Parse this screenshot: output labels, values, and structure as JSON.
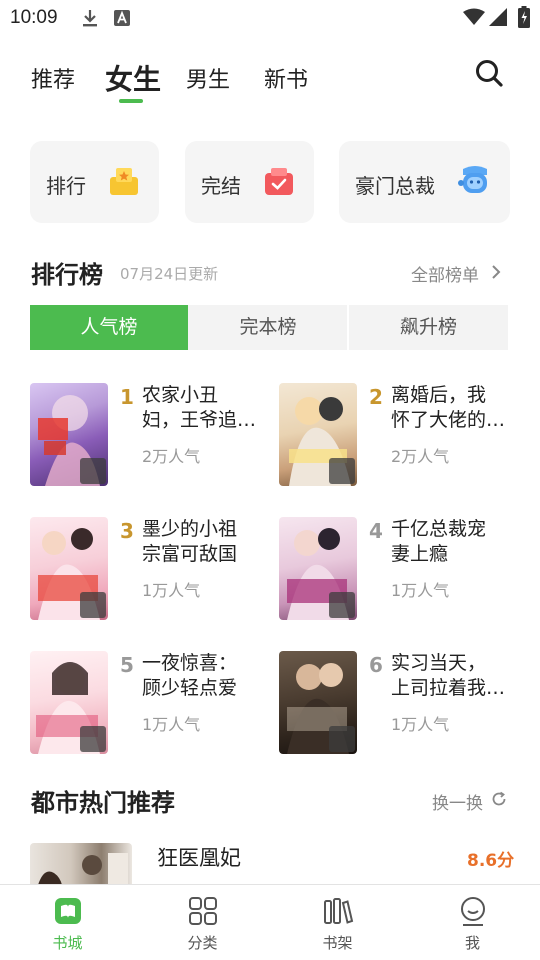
{
  "status_bar": {
    "time": "10:09"
  },
  "top_tabs": [
    {
      "label": "推荐"
    },
    {
      "label": "女生"
    },
    {
      "label": "男生"
    },
    {
      "label": "新书"
    }
  ],
  "active_top_tab": "女生",
  "shortcuts": [
    {
      "label": "排行",
      "icon": "trophy-icon"
    },
    {
      "label": "完结",
      "icon": "box-check-icon"
    },
    {
      "label": "豪门总裁",
      "icon": "mascot-icon"
    }
  ],
  "ranking": {
    "title": "排行榜",
    "updated": "07月24日更新",
    "all_link": "全部榜单",
    "tabs": [
      "人气榜",
      "完本榜",
      "飙升榜"
    ],
    "active_tab": "人气榜",
    "items": [
      {
        "rank": "1",
        "title_line1": "农家小丑",
        "title_line2": "妇，王爷追…",
        "popularity": "2万人气"
      },
      {
        "rank": "2",
        "title_line1": "离婚后，我",
        "title_line2": "怀了大佬的…",
        "popularity": "2万人气"
      },
      {
        "rank": "3",
        "title_line1": "墨少的小祖",
        "title_line2": "宗富可敌国",
        "popularity": "1万人气"
      },
      {
        "rank": "4",
        "title_line1": "千亿总裁宠",
        "title_line2": "妻上瘾",
        "popularity": "1万人气"
      },
      {
        "rank": "5",
        "title_line1": "一夜惊喜：",
        "title_line2": "顾少轻点爱",
        "popularity": "1万人气"
      },
      {
        "rank": "6",
        "title_line1": "实习当天，",
        "title_line2": "上司拉着我…",
        "popularity": "1万人气"
      }
    ]
  },
  "city_section": {
    "title": "都市热门推荐",
    "refresh": "换一换",
    "book": {
      "title": "狂医凰妃",
      "score": "8.6分"
    }
  },
  "bottom_nav": [
    {
      "label": "书城",
      "icon": "bookstore-icon"
    },
    {
      "label": "分类",
      "icon": "grid-icon"
    },
    {
      "label": "书架",
      "icon": "bookshelf-icon"
    },
    {
      "label": "我",
      "icon": "profile-icon"
    }
  ],
  "active_nav": "书城",
  "colors": {
    "accent": "#4cbb4f",
    "rank_gold": "#c8962e",
    "rank_gray": "#999999",
    "score": "#e8702a"
  }
}
